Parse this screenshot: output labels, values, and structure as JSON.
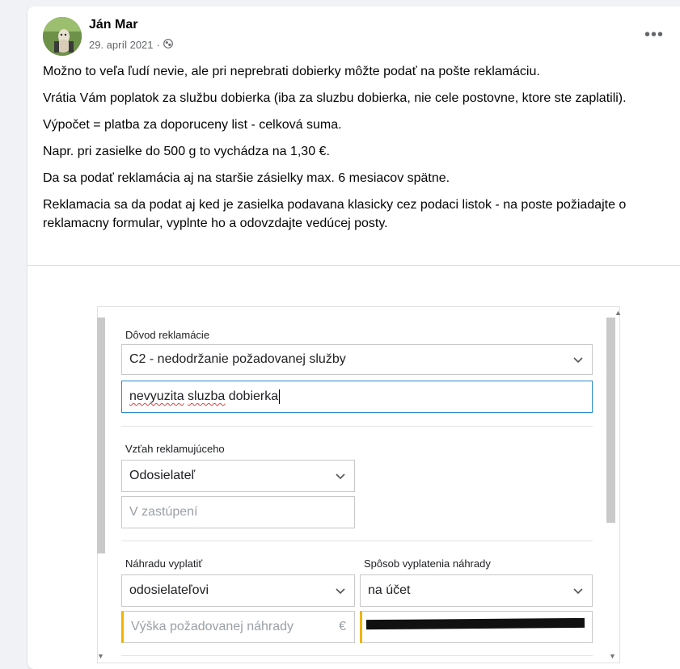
{
  "post": {
    "author": "Ján Mar",
    "date": "29. apríl 2021",
    "privacy_icon": "public-globe-icon",
    "more_icon": "more-options-icon",
    "paragraphs": [
      "Možno to veľa ľudí nevie, ale pri neprebrati dobierky môžte podať na pošte reklamáciu.",
      "Vrátia Vám poplatok za službu dobierka (iba za sluzbu dobierka, nie cele postovne, ktore ste zaplatili).",
      "Výpočet = platba za doporuceny list  - celková suma.",
      "Napr. pri zasielke do 500 g to vychádza na 1,30 €.",
      "Da sa podať reklamácia aj na staršie zásielky max. 6 mesiacov spätne.",
      "Reklamacia sa da podat aj ked je zasielka podavana klasicky cez podaci listok - na poste požiadajte o reklamacny formular, vyplnte ho a odovzdajte vedúcej posty."
    ]
  },
  "form": {
    "reason_label": "Dôvod reklamácie",
    "reason_value": "C2 - nedodržanie požadovanej služby",
    "reason_text_words": [
      "nevyuzita",
      "sluzba",
      "dobierka"
    ],
    "relation_label": "Vzťah reklamujúceho",
    "relation_value": "Odosielateľ",
    "representation_placeholder": "V zastúpení",
    "payout_label": "Náhradu vyplatiť",
    "payout_value": "odosielateľovi",
    "method_label": "Spôsob vyplatenia náhrady",
    "method_value": "na účet",
    "amount_placeholder": "Výška požadovanej náhrady",
    "currency": "€"
  },
  "colors": {
    "focus_border": "#2b8ccc",
    "required_marker": "#f0b400",
    "spellcheck": "#e04040"
  }
}
